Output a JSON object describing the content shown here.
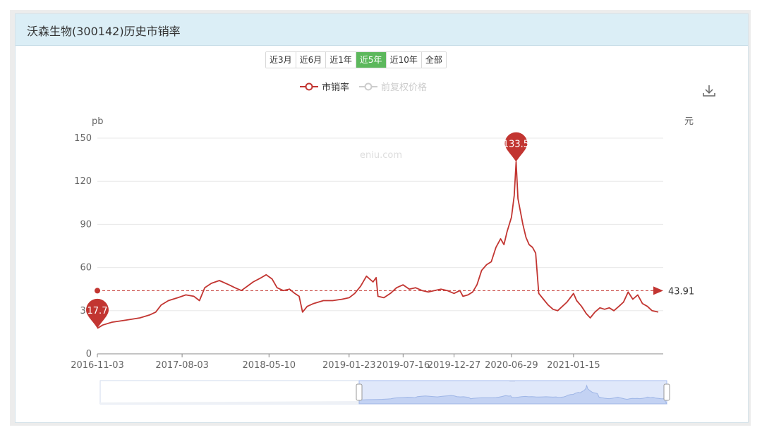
{
  "panel": {
    "title": "沃森生物(300142)历史市销率"
  },
  "range_buttons": [
    {
      "label": "近3月",
      "active": false
    },
    {
      "label": "近6月",
      "active": false
    },
    {
      "label": "近1年",
      "active": false
    },
    {
      "label": "近5年",
      "active": true
    },
    {
      "label": "近10年",
      "active": false
    },
    {
      "label": "全部",
      "active": false
    }
  ],
  "legend": [
    {
      "name": "市销率",
      "color": "#c23531",
      "active": true
    },
    {
      "name": "前复权价格",
      "color": "#cccccc",
      "active": false
    }
  ],
  "watermark": "eniu.com",
  "icons": {
    "download": "download-icon"
  },
  "chart_data": {
    "type": "line",
    "y_axis_left_label": "pb",
    "y_axis_right_label": "元",
    "ylim": [
      0,
      150
    ],
    "yticks": [
      0,
      30,
      60,
      90,
      120,
      150
    ],
    "x_range": [
      "2016-11-03",
      "2021-10-31"
    ],
    "x_ticks": [
      "2016-11-03",
      "2017-08-03",
      "2018-05-10",
      "2019-01-23",
      "2019-07-16",
      "2019-12-27",
      "2020-06-29",
      "2021-01-15"
    ],
    "grid": true,
    "legend_position": "top-center",
    "series": [
      {
        "name": "市销率",
        "color": "#c23531",
        "points": [
          [
            "2016-11-03",
            17.7
          ],
          [
            "2016-11-20",
            20
          ],
          [
            "2016-12-20",
            22
          ],
          [
            "2017-01-20",
            23
          ],
          [
            "2017-02-20",
            24
          ],
          [
            "2017-03-20",
            25
          ],
          [
            "2017-04-20",
            27
          ],
          [
            "2017-05-10",
            29
          ],
          [
            "2017-05-28",
            34
          ],
          [
            "2017-06-20",
            37
          ],
          [
            "2017-07-20",
            39
          ],
          [
            "2017-08-15",
            41
          ],
          [
            "2017-09-10",
            40
          ],
          [
            "2017-09-28",
            37
          ],
          [
            "2017-10-15",
            46
          ],
          [
            "2017-11-05",
            49
          ],
          [
            "2017-12-01",
            51
          ],
          [
            "2018-01-01",
            48
          ],
          [
            "2018-01-20",
            46
          ],
          [
            "2018-02-10",
            44
          ],
          [
            "2018-03-01",
            47
          ],
          [
            "2018-03-20",
            50
          ],
          [
            "2018-04-15",
            53
          ],
          [
            "2018-05-01",
            55
          ],
          [
            "2018-05-20",
            52
          ],
          [
            "2018-06-05",
            46
          ],
          [
            "2018-06-25",
            44
          ],
          [
            "2018-07-15",
            45
          ],
          [
            "2018-08-01",
            42
          ],
          [
            "2018-08-15",
            40
          ],
          [
            "2018-08-26",
            29
          ],
          [
            "2018-09-10",
            33
          ],
          [
            "2018-10-01",
            35
          ],
          [
            "2018-11-01",
            37
          ],
          [
            "2018-12-01",
            37
          ],
          [
            "2019-01-01",
            38
          ],
          [
            "2019-01-23",
            39
          ],
          [
            "2019-02-10",
            42
          ],
          [
            "2019-03-01",
            47
          ],
          [
            "2019-03-20",
            54
          ],
          [
            "2019-04-10",
            50
          ],
          [
            "2019-04-20",
            53
          ],
          [
            "2019-04-26",
            40
          ],
          [
            "2019-05-15",
            39
          ],
          [
            "2019-06-05",
            42
          ],
          [
            "2019-06-25",
            46
          ],
          [
            "2019-07-16",
            48
          ],
          [
            "2019-08-05",
            45
          ],
          [
            "2019-08-25",
            46
          ],
          [
            "2019-09-15",
            44
          ],
          [
            "2019-10-05",
            43
          ],
          [
            "2019-10-25",
            44
          ],
          [
            "2019-11-15",
            45
          ],
          [
            "2019-12-05",
            44
          ],
          [
            "2019-12-27",
            42
          ],
          [
            "2020-01-15",
            44
          ],
          [
            "2020-01-25",
            40
          ],
          [
            "2020-02-10",
            41
          ],
          [
            "2020-02-25",
            43
          ],
          [
            "2020-03-10",
            48
          ],
          [
            "2020-03-25",
            58
          ],
          [
            "2020-04-10",
            62
          ],
          [
            "2020-04-25",
            64
          ],
          [
            "2020-05-10",
            74
          ],
          [
            "2020-05-25",
            80
          ],
          [
            "2020-06-05",
            76
          ],
          [
            "2020-06-15",
            85
          ],
          [
            "2020-06-29",
            95
          ],
          [
            "2020-07-08",
            110
          ],
          [
            "2020-07-14",
            133.5
          ],
          [
            "2020-07-20",
            108
          ],
          [
            "2020-07-27",
            100
          ],
          [
            "2020-08-05",
            90
          ],
          [
            "2020-08-15",
            81
          ],
          [
            "2020-08-25",
            76
          ],
          [
            "2020-09-05",
            74
          ],
          [
            "2020-09-15",
            70
          ],
          [
            "2020-09-25",
            42
          ],
          [
            "2020-10-10",
            38
          ],
          [
            "2020-10-25",
            34
          ],
          [
            "2020-11-10",
            31
          ],
          [
            "2020-11-25",
            30
          ],
          [
            "2020-12-10",
            33
          ],
          [
            "2020-12-25",
            36
          ],
          [
            "2021-01-15",
            42
          ],
          [
            "2021-01-25",
            37
          ],
          [
            "2021-02-10",
            33
          ],
          [
            "2021-02-25",
            28
          ],
          [
            "2021-03-10",
            25
          ],
          [
            "2021-03-25",
            29
          ],
          [
            "2021-04-10",
            32
          ],
          [
            "2021-04-25",
            31
          ],
          [
            "2021-05-10",
            32
          ],
          [
            "2021-05-25",
            30
          ],
          [
            "2021-06-10",
            33
          ],
          [
            "2021-06-25",
            36
          ],
          [
            "2021-07-10",
            43
          ],
          [
            "2021-07-25",
            38
          ],
          [
            "2021-08-10",
            41
          ],
          [
            "2021-08-25",
            35
          ],
          [
            "2021-09-10",
            33
          ],
          [
            "2021-09-25",
            30
          ],
          [
            "2021-10-15",
            29
          ]
        ]
      }
    ],
    "mark_points": [
      {
        "label": "17.7",
        "date": "2016-11-03",
        "value": 17.7,
        "type": "min"
      },
      {
        "label": "133.5",
        "date": "2020-07-14",
        "value": 133.5,
        "type": "max"
      }
    ],
    "mark_line": {
      "label": "43.91",
      "value": 43.91,
      "type": "average"
    }
  }
}
